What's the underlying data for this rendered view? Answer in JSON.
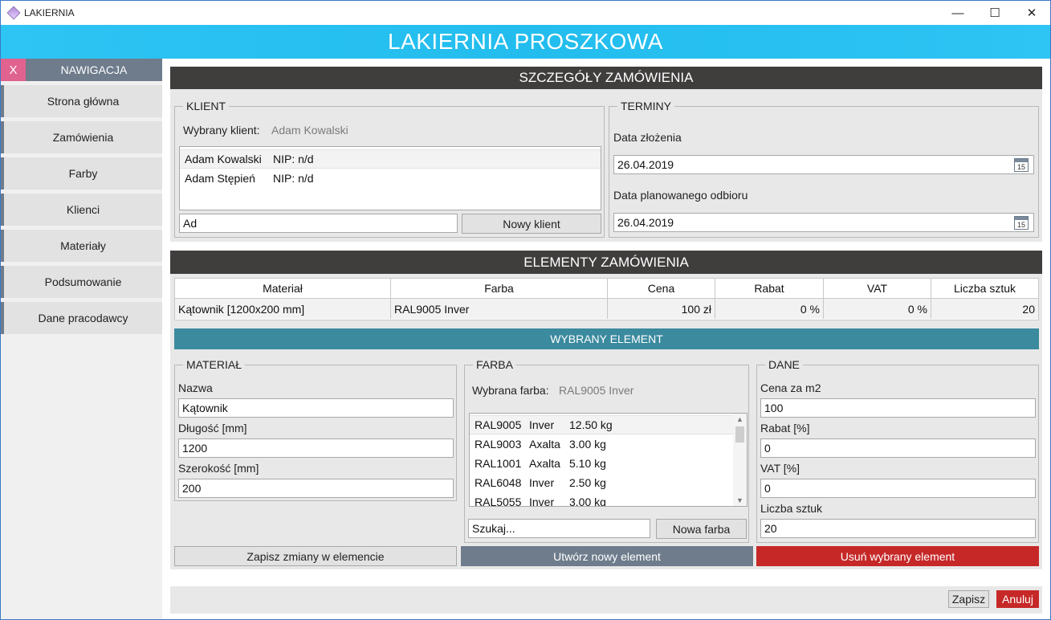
{
  "window": {
    "title": "LAKIERNIA"
  },
  "header": {
    "title": "LAKIERNIA PROSZKOWA"
  },
  "sidebar": {
    "close_label": "X",
    "title": "NAWIGACJA",
    "items": [
      "Strona główna",
      "Zamówienia",
      "Farby",
      "Klienci",
      "Materiały",
      "Podsumowanie",
      "Dane pracodawcy"
    ]
  },
  "details": {
    "title": "SZCZEGÓŁY ZAMÓWIENIA"
  },
  "client": {
    "legend": "KLIENT",
    "selected_label": "Wybrany klient:",
    "selected_value": "Adam Kowalski",
    "list": [
      {
        "name": "Adam Kowalski",
        "nip": "NIP: n/d"
      },
      {
        "name": "Adam Stępień",
        "nip": "NIP: n/d"
      }
    ],
    "search_value": "Ad",
    "new_button": "Nowy klient"
  },
  "terms": {
    "legend": "TERMINY",
    "order_date_label": "Data złożenia",
    "order_date": "26.04.2019",
    "pickup_date_label": "Data planowanego odbioru",
    "pickup_date": "26.04.2019",
    "calendar_day": "15"
  },
  "elements": {
    "title": "ELEMENTY ZAMÓWIENIA",
    "columns": [
      "Materiał",
      "Farba",
      "Cena",
      "Rabat",
      "VAT",
      "Liczba sztuk"
    ],
    "rows": [
      [
        "Kątownik [1200x200 mm]",
        "RAL9005 Inver",
        "100 zł",
        "0 %",
        "0 %",
        "20"
      ]
    ]
  },
  "selected_element": {
    "title": "WYBRANY ELEMENT"
  },
  "material": {
    "legend": "MATERIAŁ",
    "name_label": "Nazwa",
    "name_value": "Kątownik",
    "length_label": "Długość [mm]",
    "length_value": "1200",
    "width_label": "Szerokość [mm]",
    "width_value": "200"
  },
  "paint": {
    "legend": "FARBA",
    "selected_label": "Wybrana farba:",
    "selected_value": "RAL9005 Inver",
    "list": [
      {
        "code": "RAL9005",
        "brand": "Inver",
        "qty": "12.50 kg"
      },
      {
        "code": "RAL9003",
        "brand": "Axalta",
        "qty": "3.00 kg"
      },
      {
        "code": "RAL1001",
        "brand": "Axalta",
        "qty": "5.10 kg"
      },
      {
        "code": "RAL6048",
        "brand": "Inver",
        "qty": "2.50 kg"
      },
      {
        "code": "RAL5055",
        "brand": "Inver",
        "qty": "3.00 kg"
      }
    ],
    "search_value": "Szukaj...",
    "new_button": "Nowa farba"
  },
  "data": {
    "legend": "DANE",
    "price_label": "Cena za m2",
    "price_value": "100",
    "discount_label": "Rabat [%]",
    "discount_value": "0",
    "vat_label": "VAT [%]",
    "vat_value": "0",
    "count_label": "Liczba sztuk",
    "count_value": "20"
  },
  "actions": {
    "save_changes": "Zapisz zmiany w elemencie",
    "create_new": "Utwórz nowy element",
    "delete": "Usuń wybrany element",
    "create_color": "#6e7c8c",
    "delete_color": "#c62828"
  },
  "footer": {
    "save": "Zapisz",
    "cancel": "Anuluj"
  }
}
